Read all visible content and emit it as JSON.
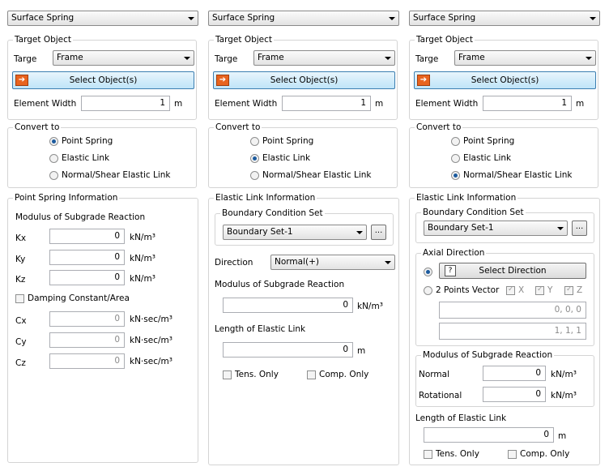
{
  "panels": [
    {
      "type_select": "Surface Spring",
      "target_object": {
        "legend": "Target Object",
        "targe_label": "Targe",
        "targe_value": "Frame",
        "select_button": "Select Object(s)",
        "element_width_label": "Element Width",
        "element_width_value": "1",
        "element_width_unit": "m"
      },
      "convert_to": {
        "legend": "Convert to",
        "options": [
          "Point Spring",
          "Elastic Link",
          "Normal/Shear Elastic Link"
        ],
        "selected": "Point Spring"
      },
      "info": {
        "legend": "Point Spring Information",
        "modulus_label": "Modulus of Subgrade Reaction",
        "kx_label": "Kx",
        "kx_value": "0",
        "kx_unit": "kN/m³",
        "ky_label": "Ky",
        "ky_value": "0",
        "ky_unit": "kN/m³",
        "kz_label": "Kz",
        "kz_value": "0",
        "kz_unit": "kN/m³",
        "damping_label": "Damping Constant/Area",
        "cx_label": "Cx",
        "cx_value": "0",
        "cx_unit": "kN·sec/m³",
        "cy_label": "Cy",
        "cy_value": "0",
        "cy_unit": "kN·sec/m³",
        "cz_label": "Cz",
        "cz_value": "0",
        "cz_unit": "kN·sec/m³"
      }
    },
    {
      "type_select": "Surface Spring",
      "target_object": {
        "legend": "Target Object",
        "targe_label": "Targe",
        "targe_value": "Frame",
        "select_button": "Select Object(s)",
        "element_width_label": "Element Width",
        "element_width_value": "1",
        "element_width_unit": "m"
      },
      "convert_to": {
        "legend": "Convert to",
        "options": [
          "Point Spring",
          "Elastic Link",
          "Normal/Shear Elastic Link"
        ],
        "selected": "Elastic Link"
      },
      "info": {
        "legend": "Elastic Link Information",
        "bc_legend": "Boundary Condition Set",
        "bc_value": "Boundary Set-1",
        "bc_more": "...",
        "direction_label": "Direction",
        "direction_value": "Normal(+)",
        "modulus_label": "Modulus of Subgrade Reaction",
        "modulus_value": "0",
        "modulus_unit": "kN/m³",
        "length_label": "Length of Elastic Link",
        "length_value": "0",
        "length_unit": "m",
        "tens_only": "Tens. Only",
        "comp_only": "Comp. Only"
      }
    },
    {
      "type_select": "Surface Spring",
      "target_object": {
        "legend": "Target Object",
        "targe_label": "Targe",
        "targe_value": "Frame",
        "select_button": "Select Object(s)",
        "element_width_label": "Element Width",
        "element_width_value": "1",
        "element_width_unit": "m"
      },
      "convert_to": {
        "legend": "Convert to",
        "options": [
          "Point Spring",
          "Elastic Link",
          "Normal/Shear Elastic Link"
        ],
        "selected": "Normal/Shear Elastic Link"
      },
      "info": {
        "legend": "Elastic Link Information",
        "bc_legend": "Boundary Condition Set",
        "bc_value": "Boundary Set-1",
        "bc_more": "...",
        "axial_legend": "Axial Direction",
        "select_direction": "Select Direction",
        "select_direction_icon": "?",
        "two_points": "2 Points Vector",
        "x_label": "X",
        "y_label": "Y",
        "z_label": "Z",
        "p1_value": "0, 0, 0",
        "p2_value": "1, 1, 1",
        "modulus_legend": "Modulus of Subgrade Reaction",
        "normal_label": "Normal",
        "normal_value": "0",
        "normal_unit": "kN/m³",
        "rotational_label": "Rotational",
        "rotational_value": "0",
        "rotational_unit": "kN/m³",
        "length_label": "Length of Elastic Link",
        "length_value": "0",
        "length_unit": "m",
        "tens_only": "Tens. Only",
        "comp_only": "Comp. Only"
      }
    }
  ]
}
